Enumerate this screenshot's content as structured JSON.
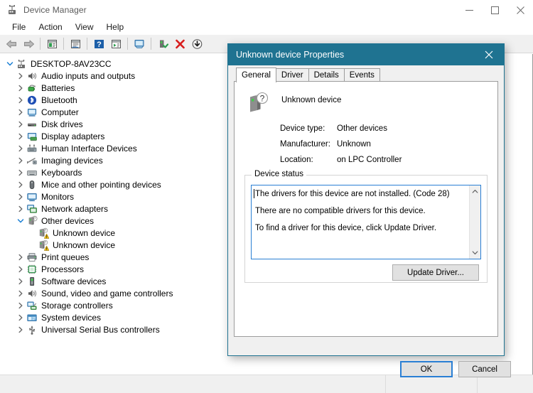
{
  "window": {
    "title": "Device Manager",
    "icon": "device-manager-icon",
    "caption_buttons": [
      {
        "name": "minimize",
        "glyph": "─"
      },
      {
        "name": "maximize",
        "glyph": "☐"
      },
      {
        "name": "close",
        "glyph": "✕"
      }
    ]
  },
  "menubar": {
    "items": [
      {
        "label": "File"
      },
      {
        "label": "Action"
      },
      {
        "label": "View"
      },
      {
        "label": "Help"
      }
    ]
  },
  "toolbar": {
    "buttons": [
      {
        "name": "back-button",
        "icon": "back-arrow-icon"
      },
      {
        "name": "forward-button",
        "icon": "forward-arrow-icon"
      },
      {
        "name": "show-hide-console-tree-button",
        "icon": "console-tree-icon"
      },
      {
        "name": "properties-button",
        "icon": "properties-icon"
      },
      {
        "name": "help-button",
        "icon": "help-question-icon"
      },
      {
        "name": "update-driver-button",
        "icon": "update-driver-icon"
      },
      {
        "name": "scan-hardware-changes-button",
        "icon": "scan-monitor-icon"
      },
      {
        "name": "enable-device-button",
        "icon": "enable-device-icon"
      },
      {
        "name": "uninstall-device-button",
        "icon": "uninstall-red-x-icon"
      },
      {
        "name": "add-legacy-hardware-button",
        "icon": "download-circle-icon"
      }
    ]
  },
  "tree": {
    "root": {
      "label": "DESKTOP-8AV23CC",
      "icon": "computer-root-icon",
      "expanded": true
    },
    "items": [
      {
        "label": "Audio inputs and outputs",
        "icon": "audio-icon",
        "depth": 1,
        "expandable": true
      },
      {
        "label": "Batteries",
        "icon": "battery-icon",
        "depth": 1,
        "expandable": true
      },
      {
        "label": "Bluetooth",
        "icon": "bluetooth-icon",
        "depth": 1,
        "expandable": true
      },
      {
        "label": "Computer",
        "icon": "computer-icon",
        "depth": 1,
        "expandable": true
      },
      {
        "label": "Disk drives",
        "icon": "disk-drive-icon",
        "depth": 1,
        "expandable": true
      },
      {
        "label": "Display adapters",
        "icon": "display-adapter-icon",
        "depth": 1,
        "expandable": true
      },
      {
        "label": "Human Interface Devices",
        "icon": "hid-icon",
        "depth": 1,
        "expandable": true
      },
      {
        "label": "Imaging devices",
        "icon": "imaging-device-icon",
        "depth": 1,
        "expandable": true
      },
      {
        "label": "Keyboards",
        "icon": "keyboard-icon",
        "depth": 1,
        "expandable": true
      },
      {
        "label": "Mice and other pointing devices",
        "icon": "mouse-icon",
        "depth": 1,
        "expandable": true
      },
      {
        "label": "Monitors",
        "icon": "monitor-icon",
        "depth": 1,
        "expandable": true
      },
      {
        "label": "Network adapters",
        "icon": "network-adapter-icon",
        "depth": 1,
        "expandable": true
      },
      {
        "label": "Other devices",
        "icon": "other-devices-icon",
        "depth": 1,
        "expandable": true,
        "expanded": true
      },
      {
        "label": "Unknown device",
        "icon": "unknown-device-warning-icon",
        "depth": 2,
        "expandable": false
      },
      {
        "label": "Unknown device",
        "icon": "unknown-device-warning-icon",
        "depth": 2,
        "expandable": false
      },
      {
        "label": "Print queues",
        "icon": "printer-icon",
        "depth": 1,
        "expandable": true
      },
      {
        "label": "Processors",
        "icon": "processor-icon",
        "depth": 1,
        "expandable": true
      },
      {
        "label": "Software devices",
        "icon": "software-device-icon",
        "depth": 1,
        "expandable": true
      },
      {
        "label": "Sound, video and game controllers",
        "icon": "sound-video-game-icon",
        "depth": 1,
        "expandable": true
      },
      {
        "label": "Storage controllers",
        "icon": "storage-controller-icon",
        "depth": 1,
        "expandable": true
      },
      {
        "label": "System devices",
        "icon": "system-device-icon",
        "depth": 1,
        "expandable": true
      },
      {
        "label": "Universal Serial Bus controllers",
        "icon": "usb-controller-icon",
        "depth": 1,
        "expandable": true
      }
    ]
  },
  "statusbar": {
    "panes": [
      "",
      "",
      ""
    ]
  },
  "dialog": {
    "title": "Unknown device Properties",
    "close_glyph": "✕",
    "tabs": [
      {
        "label": "General",
        "active": true
      },
      {
        "label": "Driver",
        "active": false
      },
      {
        "label": "Details",
        "active": false
      },
      {
        "label": "Events",
        "active": false
      }
    ],
    "device": {
      "name": "Unknown device",
      "icon": "unknown-device-question-icon",
      "properties": [
        {
          "key": "Device type:",
          "value": "Other devices"
        },
        {
          "key": "Manufacturer:",
          "value": "Unknown"
        },
        {
          "key": "Location:",
          "value": "on LPC Controller"
        }
      ]
    },
    "device_status": {
      "legend": "Device status",
      "lines": [
        "The drivers for this device are not installed. (Code 28)",
        "There are no compatible drivers for this device.",
        "",
        "To find a driver for this device, click Update Driver."
      ],
      "scroll_up_glyph": "∧",
      "scroll_down_glyph": "∨"
    },
    "update_driver_label": "Update Driver...",
    "ok_label": "OK",
    "cancel_label": "Cancel"
  },
  "colors": {
    "dialog_titlebar": "#1f7391",
    "focus_border": "#2a7fd4",
    "toolbar_bg": "#f0f0f0",
    "warning_yellow": "#ffc700",
    "error_red": "#d81e1e"
  }
}
